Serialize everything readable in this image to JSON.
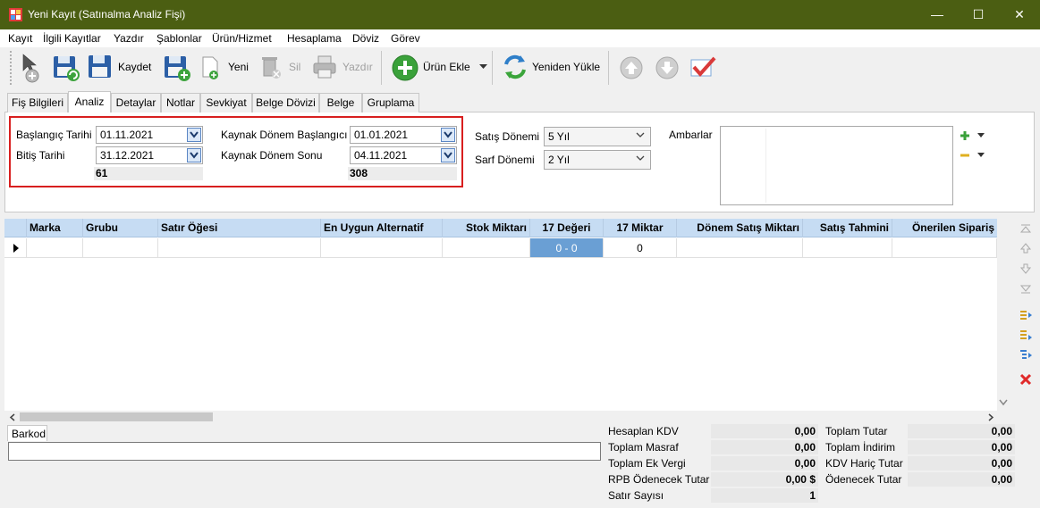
{
  "window": {
    "title": "Yeni Kayıt (Satınalma Analiz Fişi)",
    "minimize_glyph": "—",
    "maximize_glyph": "☐",
    "close_glyph": "✕"
  },
  "menu": {
    "items": [
      "Kayıt",
      "İlgili Kayıtlar",
      "Yazdır",
      "Şablonlar",
      "Ürün/Hizmet",
      "Hesaplama",
      "Döviz",
      "Görev"
    ]
  },
  "toolbar": {
    "kaydet_label": "Kaydet",
    "yeni_label": "Yeni",
    "sil_label": "Sil",
    "yazdir_label": "Yazdır",
    "urun_ekle_label": "Ürün Ekle",
    "yeniden_yukle_label": "Yeniden Yükle"
  },
  "tabs": [
    "Fiş Bilgileri",
    "Analiz",
    "Detaylar",
    "Notlar",
    "Sevkiyat",
    "Belge Dövizi",
    "Belge",
    "Gruplama"
  ],
  "active_tab": "Analiz",
  "analiz": {
    "baslangic_label": "Başlangıç Tarihi",
    "baslangic_value": "01.11.2021",
    "bitis_label": "Bitiş Tarihi",
    "bitis_value": "31.12.2021",
    "gun_sayisi": "61",
    "kaynak_baslangic_label": "Kaynak Dönem Başlangıcı",
    "kaynak_baslangic_value": "01.01.2021",
    "kaynak_sonu_label": "Kaynak Dönem Sonu",
    "kaynak_sonu_value": "04.11.2021",
    "kaynak_gun_sayisi": "308",
    "satis_donemi_label": "Satış Dönemi",
    "satis_donemi_value": "5 Yıl",
    "sarf_donemi_label": "Sarf Dönemi",
    "sarf_donemi_value": "2 Yıl",
    "ambarlar_label": "Ambarlar"
  },
  "grid": {
    "columns": [
      "Marka",
      "Grubu",
      "Satır Öğesi",
      "En Uygun Alternatif",
      "Stok Miktarı",
      "17 Değeri",
      "17 Miktar",
      "Dönem Satış Miktarı",
      "Satış Tahmini",
      "Önerilen Sipariş"
    ],
    "rows": [
      [
        "",
        "",
        "",
        "",
        "",
        "0 - 0",
        "0",
        "",
        "",
        ""
      ]
    ]
  },
  "barkod": {
    "tab_label": "Barkod",
    "value": ""
  },
  "totals": {
    "left": [
      {
        "label": "Hesaplan KDV",
        "value": "0,00"
      },
      {
        "label": "Toplam Masraf",
        "value": "0,00"
      },
      {
        "label": "Toplam Ek Vergi",
        "value": "0,00"
      },
      {
        "label": "RPB Ödenecek Tutar",
        "value": "0,00 $"
      },
      {
        "label": "Satır Sayısı",
        "value": "1"
      }
    ],
    "right": [
      {
        "label": "Toplam Tutar",
        "value": "0,00"
      },
      {
        "label": "Toplam İndirim",
        "value": "0,00"
      },
      {
        "label": "KDV Hariç Tutar",
        "value": "0,00"
      },
      {
        "label": "Ödenecek Tutar",
        "value": "0,00"
      }
    ]
  },
  "colors": {
    "titlebar": "#4b5e12",
    "highlight_border": "#d81f1f",
    "grid_header": "#c6dcf3",
    "selected_cell": "#6a9fd4"
  }
}
